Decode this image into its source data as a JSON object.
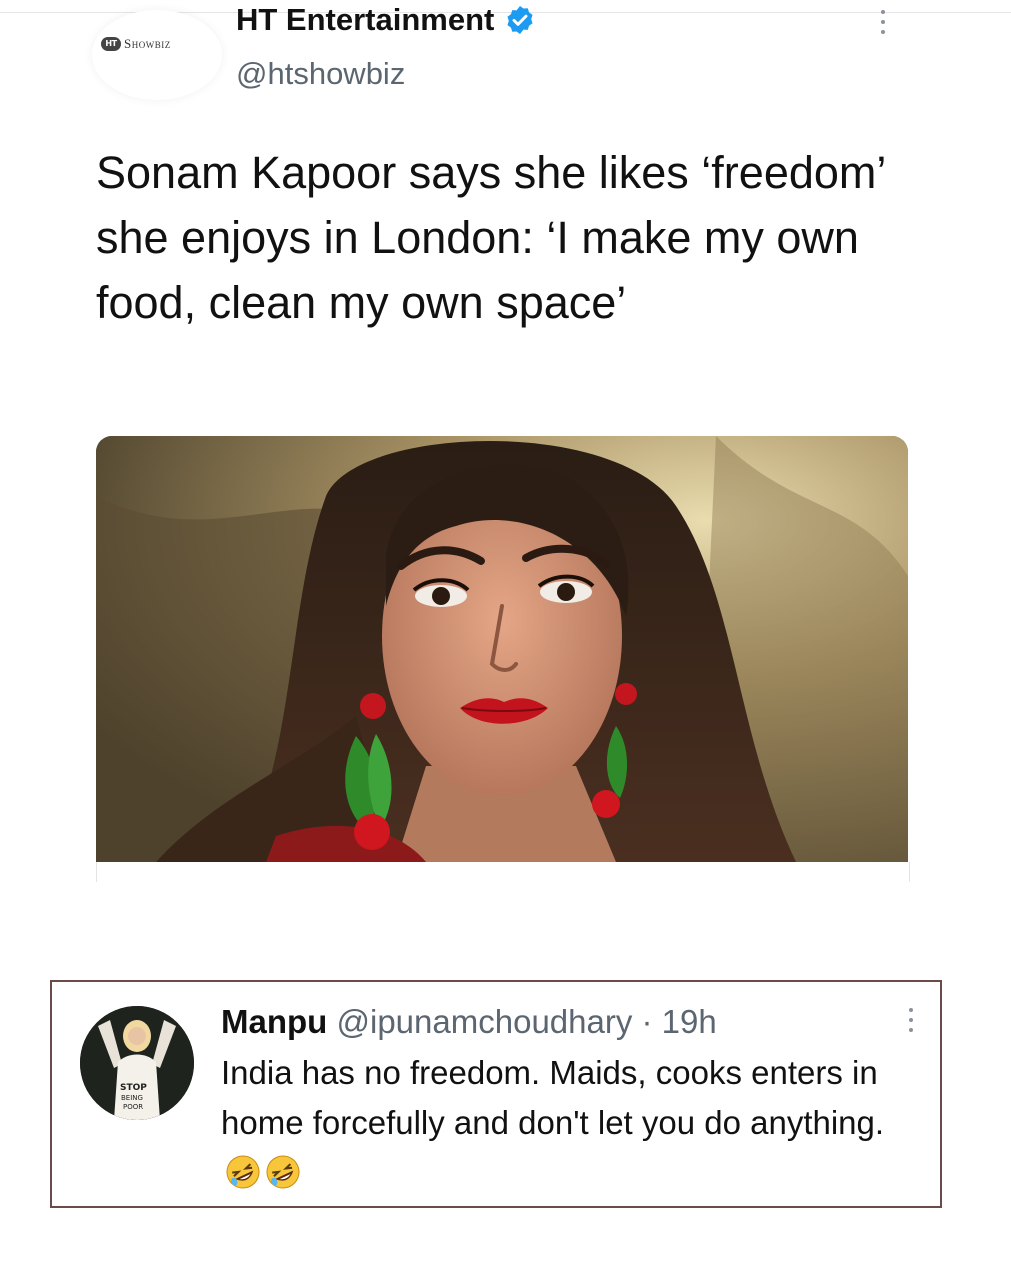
{
  "tweet": {
    "author_name": "HT Entertainment",
    "author_handle": "@htshowbiz",
    "logo_badge": "HT",
    "logo_word": "Showbiz",
    "headline": "Sonam Kapoor says she likes ‘freedom’ she enjoys in London: ‘I make my own food, clean my own space’",
    "verified_color": "#1d9bf0",
    "more_icon": "more-vertical-icon",
    "verified_icon": "verified-badge-icon"
  },
  "reply": {
    "name": "Manpu",
    "handle": "@ipunamchoudhary",
    "separator": " · ",
    "time": "19h",
    "text": "India has no freedom. Maids, cooks enters in home forcefully and don't let you do anything.",
    "emojis": [
      "rolling-on-floor-laughing-emoji",
      "rolling-on-floor-laughing-emoji"
    ],
    "avatar_shirt_text": "STOP BEING POOR",
    "border_color": "#6b4a4a",
    "more_icon": "more-vertical-icon"
  }
}
